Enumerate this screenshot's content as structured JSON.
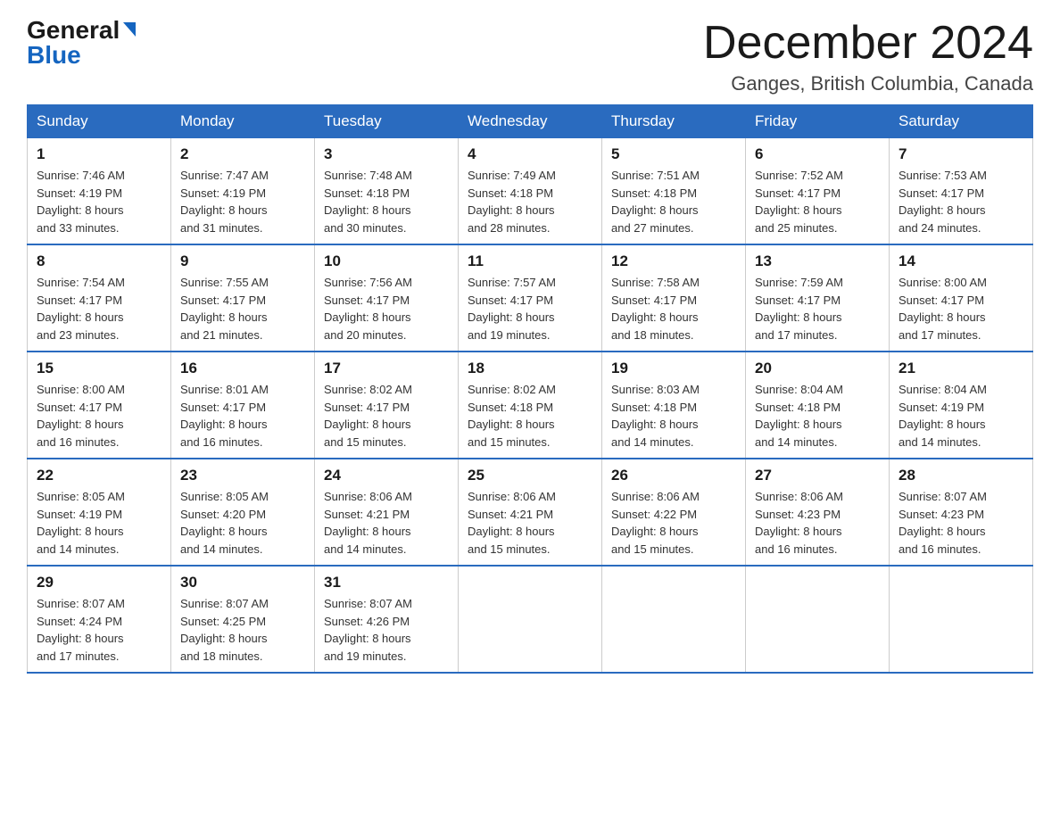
{
  "header": {
    "logo_line1": "General",
    "logo_line2": "Blue",
    "month": "December 2024",
    "location": "Ganges, British Columbia, Canada"
  },
  "weekdays": [
    "Sunday",
    "Monday",
    "Tuesday",
    "Wednesday",
    "Thursday",
    "Friday",
    "Saturday"
  ],
  "weeks": [
    [
      {
        "day": "1",
        "sunrise": "7:46 AM",
        "sunset": "4:19 PM",
        "daylight": "8 hours and 33 minutes."
      },
      {
        "day": "2",
        "sunrise": "7:47 AM",
        "sunset": "4:19 PM",
        "daylight": "8 hours and 31 minutes."
      },
      {
        "day": "3",
        "sunrise": "7:48 AM",
        "sunset": "4:18 PM",
        "daylight": "8 hours and 30 minutes."
      },
      {
        "day": "4",
        "sunrise": "7:49 AM",
        "sunset": "4:18 PM",
        "daylight": "8 hours and 28 minutes."
      },
      {
        "day": "5",
        "sunrise": "7:51 AM",
        "sunset": "4:18 PM",
        "daylight": "8 hours and 27 minutes."
      },
      {
        "day": "6",
        "sunrise": "7:52 AM",
        "sunset": "4:17 PM",
        "daylight": "8 hours and 25 minutes."
      },
      {
        "day": "7",
        "sunrise": "7:53 AM",
        "sunset": "4:17 PM",
        "daylight": "8 hours and 24 minutes."
      }
    ],
    [
      {
        "day": "8",
        "sunrise": "7:54 AM",
        "sunset": "4:17 PM",
        "daylight": "8 hours and 23 minutes."
      },
      {
        "day": "9",
        "sunrise": "7:55 AM",
        "sunset": "4:17 PM",
        "daylight": "8 hours and 21 minutes."
      },
      {
        "day": "10",
        "sunrise": "7:56 AM",
        "sunset": "4:17 PM",
        "daylight": "8 hours and 20 minutes."
      },
      {
        "day": "11",
        "sunrise": "7:57 AM",
        "sunset": "4:17 PM",
        "daylight": "8 hours and 19 minutes."
      },
      {
        "day": "12",
        "sunrise": "7:58 AM",
        "sunset": "4:17 PM",
        "daylight": "8 hours and 18 minutes."
      },
      {
        "day": "13",
        "sunrise": "7:59 AM",
        "sunset": "4:17 PM",
        "daylight": "8 hours and 17 minutes."
      },
      {
        "day": "14",
        "sunrise": "8:00 AM",
        "sunset": "4:17 PM",
        "daylight": "8 hours and 17 minutes."
      }
    ],
    [
      {
        "day": "15",
        "sunrise": "8:00 AM",
        "sunset": "4:17 PM",
        "daylight": "8 hours and 16 minutes."
      },
      {
        "day": "16",
        "sunrise": "8:01 AM",
        "sunset": "4:17 PM",
        "daylight": "8 hours and 16 minutes."
      },
      {
        "day": "17",
        "sunrise": "8:02 AM",
        "sunset": "4:17 PM",
        "daylight": "8 hours and 15 minutes."
      },
      {
        "day": "18",
        "sunrise": "8:02 AM",
        "sunset": "4:18 PM",
        "daylight": "8 hours and 15 minutes."
      },
      {
        "day": "19",
        "sunrise": "8:03 AM",
        "sunset": "4:18 PM",
        "daylight": "8 hours and 14 minutes."
      },
      {
        "day": "20",
        "sunrise": "8:04 AM",
        "sunset": "4:18 PM",
        "daylight": "8 hours and 14 minutes."
      },
      {
        "day": "21",
        "sunrise": "8:04 AM",
        "sunset": "4:19 PM",
        "daylight": "8 hours and 14 minutes."
      }
    ],
    [
      {
        "day": "22",
        "sunrise": "8:05 AM",
        "sunset": "4:19 PM",
        "daylight": "8 hours and 14 minutes."
      },
      {
        "day": "23",
        "sunrise": "8:05 AM",
        "sunset": "4:20 PM",
        "daylight": "8 hours and 14 minutes."
      },
      {
        "day": "24",
        "sunrise": "8:06 AM",
        "sunset": "4:21 PM",
        "daylight": "8 hours and 14 minutes."
      },
      {
        "day": "25",
        "sunrise": "8:06 AM",
        "sunset": "4:21 PM",
        "daylight": "8 hours and 15 minutes."
      },
      {
        "day": "26",
        "sunrise": "8:06 AM",
        "sunset": "4:22 PM",
        "daylight": "8 hours and 15 minutes."
      },
      {
        "day": "27",
        "sunrise": "8:06 AM",
        "sunset": "4:23 PM",
        "daylight": "8 hours and 16 minutes."
      },
      {
        "day": "28",
        "sunrise": "8:07 AM",
        "sunset": "4:23 PM",
        "daylight": "8 hours and 16 minutes."
      }
    ],
    [
      {
        "day": "29",
        "sunrise": "8:07 AM",
        "sunset": "4:24 PM",
        "daylight": "8 hours and 17 minutes."
      },
      {
        "day": "30",
        "sunrise": "8:07 AM",
        "sunset": "4:25 PM",
        "daylight": "8 hours and 18 minutes."
      },
      {
        "day": "31",
        "sunrise": "8:07 AM",
        "sunset": "4:26 PM",
        "daylight": "8 hours and 19 minutes."
      },
      null,
      null,
      null,
      null
    ]
  ],
  "labels": {
    "sunrise_prefix": "Sunrise: ",
    "sunset_prefix": "Sunset: ",
    "daylight_prefix": "Daylight: "
  }
}
